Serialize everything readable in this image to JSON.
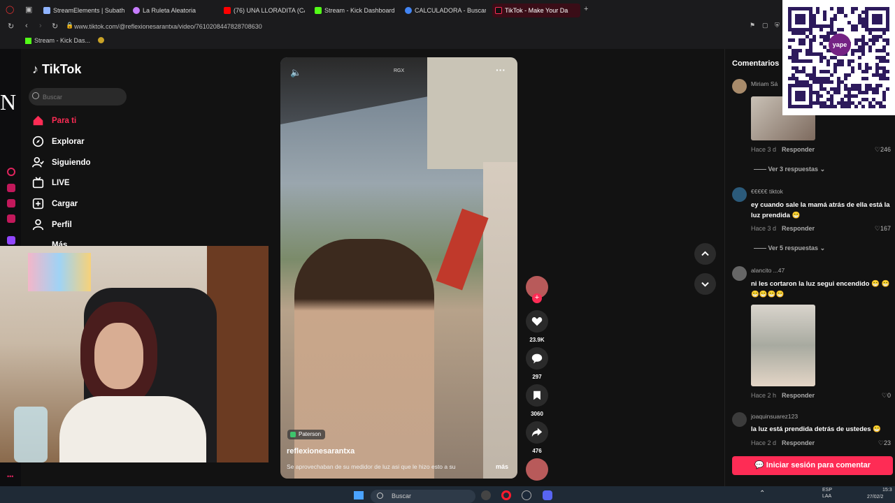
{
  "browser": {
    "tabs": [
      {
        "label": "StreamElements | Subatho"
      },
      {
        "label": "La Ruleta Aleatoria"
      },
      {
        "label": "(76) UNA LLORADITA (CA"
      },
      {
        "label": "Stream - Kick Dashboard"
      },
      {
        "label": "CALCULADORA - Buscar c"
      },
      {
        "label": "TikTok - Make Your Da"
      }
    ],
    "url": "www.tiktok.com/@reflexionesarantxa/video/7610208447828708630",
    "bookmark": "Stream - Kick Das..."
  },
  "tiktok": {
    "logo": "TikTok",
    "search_placeholder": "Buscar",
    "nav": [
      "Para ti",
      "Explorar",
      "Siguiendo",
      "LIVE",
      "Cargar",
      "Perfil",
      "Más"
    ],
    "video": {
      "watermark": "RGX",
      "location_tag": "Paterson",
      "username": "reflexionesarantxa",
      "caption": "Se aprovechaban de su medidor de luz asi que le hizo esto a su",
      "more": "más"
    },
    "actions": {
      "likes": "23.9K",
      "comments": "297",
      "saves": "3060",
      "shares": "476"
    }
  },
  "comments": {
    "title": "Comentarios",
    "items": [
      {
        "name": "Miriam Sá",
        "text": "",
        "time": "Hace 3 d",
        "reply": "Responder",
        "likes": "246",
        "more": "Ver 3 respuestas"
      },
      {
        "name": "€€€€€ tiktok",
        "text": "ey cuando sale la mamá atrás de ella está la luz prendida 😁",
        "time": "Hace 3 d",
        "reply": "Responder",
        "likes": "167",
        "more": "Ver 5 respuestas"
      },
      {
        "name": "alancito ...47",
        "text": "ni les cortaron la luz segui encendido 😁 😁😁😁😁😁",
        "time": "Hace 2 h",
        "reply": "Responder",
        "likes": "0"
      },
      {
        "name": "joaquinsuarez123",
        "text": "la luz está prendida detrás de ustedes 😁",
        "time": "Hace 2 d",
        "reply": "Responder",
        "likes": "23"
      }
    ],
    "login_button": "Iniciar sesión para comentar"
  },
  "overlay": {
    "qr_brand": "yape",
    "cam_letter": "N"
  },
  "taskbar": {
    "search": "Buscar",
    "lang": "ESP",
    "lang2": "LAA",
    "time": "15:3",
    "date": "27/02/2"
  },
  "colors": {
    "accent": "#fe2c55",
    "page_bg": "#121212",
    "chrome": "#1b1b1d"
  }
}
